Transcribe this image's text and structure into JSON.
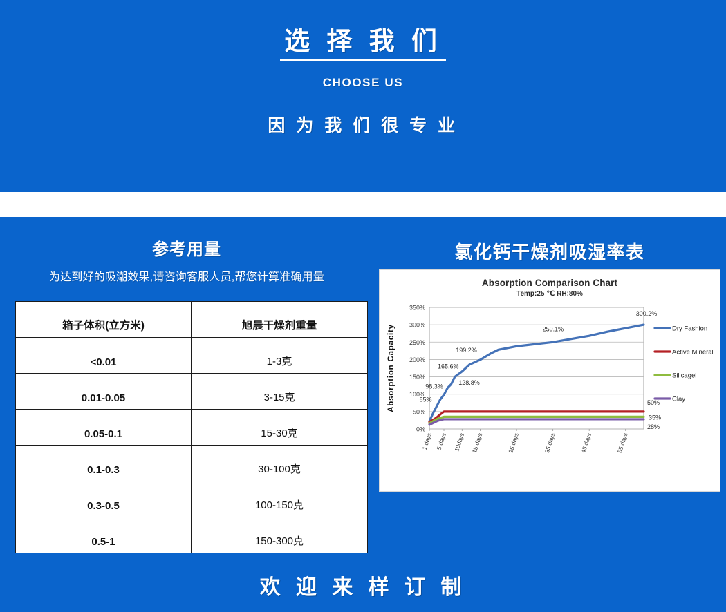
{
  "theme": {
    "background_blue": "#0a64cc",
    "card_white": "#ffffff",
    "text_dark": "#111111"
  },
  "hero": {
    "title": "选 择 我 们",
    "subtitle": "CHOOSE US",
    "slogan": "因 为 我 们 很 专 业"
  },
  "left_section": {
    "title": "参考用量",
    "description": "为达到好的吸潮效果,请咨询客服人员,帮您计算准确用量",
    "table": {
      "headers": [
        "箱子体积(立方米)",
        "旭晨干燥剂重量"
      ],
      "rows": [
        [
          "<0.01",
          "1-3克"
        ],
        [
          "0.01-0.05",
          "3-15克"
        ],
        [
          "0.05-0.1",
          "15-30克"
        ],
        [
          "0.1-0.3",
          "30-100克"
        ],
        [
          "0.3-0.5",
          "100-150克"
        ],
        [
          "0.5-1",
          "150-300克"
        ]
      ]
    }
  },
  "right_section": {
    "title": "氯化钙干燥剂吸湿率表"
  },
  "footer": {
    "text": "欢 迎 来 样 订 制"
  },
  "chart_data": {
    "type": "line",
    "title": "Absorption Comparison Chart",
    "subtitle": "Temp:25 ℃ RH:80%",
    "xlabel": "",
    "ylabel": "Absorption Capacity",
    "ylim": [
      0,
      350
    ],
    "ytick_labels": [
      "0%",
      "50%",
      "100%",
      "150%",
      "200%",
      "250%",
      "300%",
      "350%"
    ],
    "ytick_values": [
      0,
      50,
      100,
      150,
      200,
      250,
      300,
      350
    ],
    "xtick_labels": [
      "1 days",
      "5 days",
      "10days",
      "15 days",
      "25 days",
      "35 days",
      "45 days",
      "55 days"
    ],
    "xtick_values": [
      1,
      5,
      10,
      15,
      25,
      35,
      45,
      55
    ],
    "grid": true,
    "legend_position": "right",
    "series": [
      {
        "name": "Dry Fashion",
        "color": "#4472b8",
        "x": [
          1,
          2,
          3,
          4,
          5,
          6,
          7,
          8,
          10,
          12,
          15,
          18,
          20,
          25,
          30,
          35,
          40,
          45,
          50,
          55,
          60
        ],
        "values": [
          22,
          45,
          65,
          85,
          98.3,
          118,
          128.8,
          150,
          165.6,
          185,
          199.2,
          218,
          228,
          238,
          244,
          250,
          259.1,
          268,
          280,
          290,
          300.2
        ]
      },
      {
        "name": "Active Mineral",
        "color": "#b52025",
        "x": [
          1,
          2,
          3,
          4,
          5,
          10,
          20,
          30,
          40,
          50,
          60
        ],
        "values": [
          20,
          26,
          33,
          42,
          50,
          50,
          50,
          50,
          50,
          50,
          50
        ]
      },
      {
        "name": "Silicagel",
        "color": "#8fbc3f",
        "x": [
          1,
          2,
          3,
          4,
          5,
          10,
          20,
          30,
          40,
          50,
          60
        ],
        "values": [
          16,
          22,
          28,
          32,
          35,
          35,
          35,
          35,
          35,
          35,
          35
        ]
      },
      {
        "name": "Clay",
        "color": "#7a5ca8",
        "x": [
          1,
          2,
          3,
          4,
          5,
          10,
          20,
          30,
          40,
          50,
          60
        ],
        "values": [
          12,
          17,
          22,
          26,
          28,
          28,
          28,
          28,
          28,
          28,
          28
        ]
      }
    ],
    "annotations": [
      {
        "text": "65%",
        "x": 3,
        "y": 65
      },
      {
        "text": "98.3%",
        "x": 5,
        "y": 98.3
      },
      {
        "text": "128.8%",
        "x": 7,
        "y": 128.8
      },
      {
        "text": "165.6%",
        "x": 10,
        "y": 165.6
      },
      {
        "text": "199.2%",
        "x": 15,
        "y": 199.2
      },
      {
        "text": "259.1%",
        "x": 40,
        "y": 259.1
      },
      {
        "text": "300.2%",
        "x": 60,
        "y": 300.2
      },
      {
        "text": "50%",
        "x": 60,
        "y": 50
      },
      {
        "text": "35%",
        "x": 60,
        "y": 35
      },
      {
        "text": "28%",
        "x": 60,
        "y": 28
      }
    ]
  }
}
